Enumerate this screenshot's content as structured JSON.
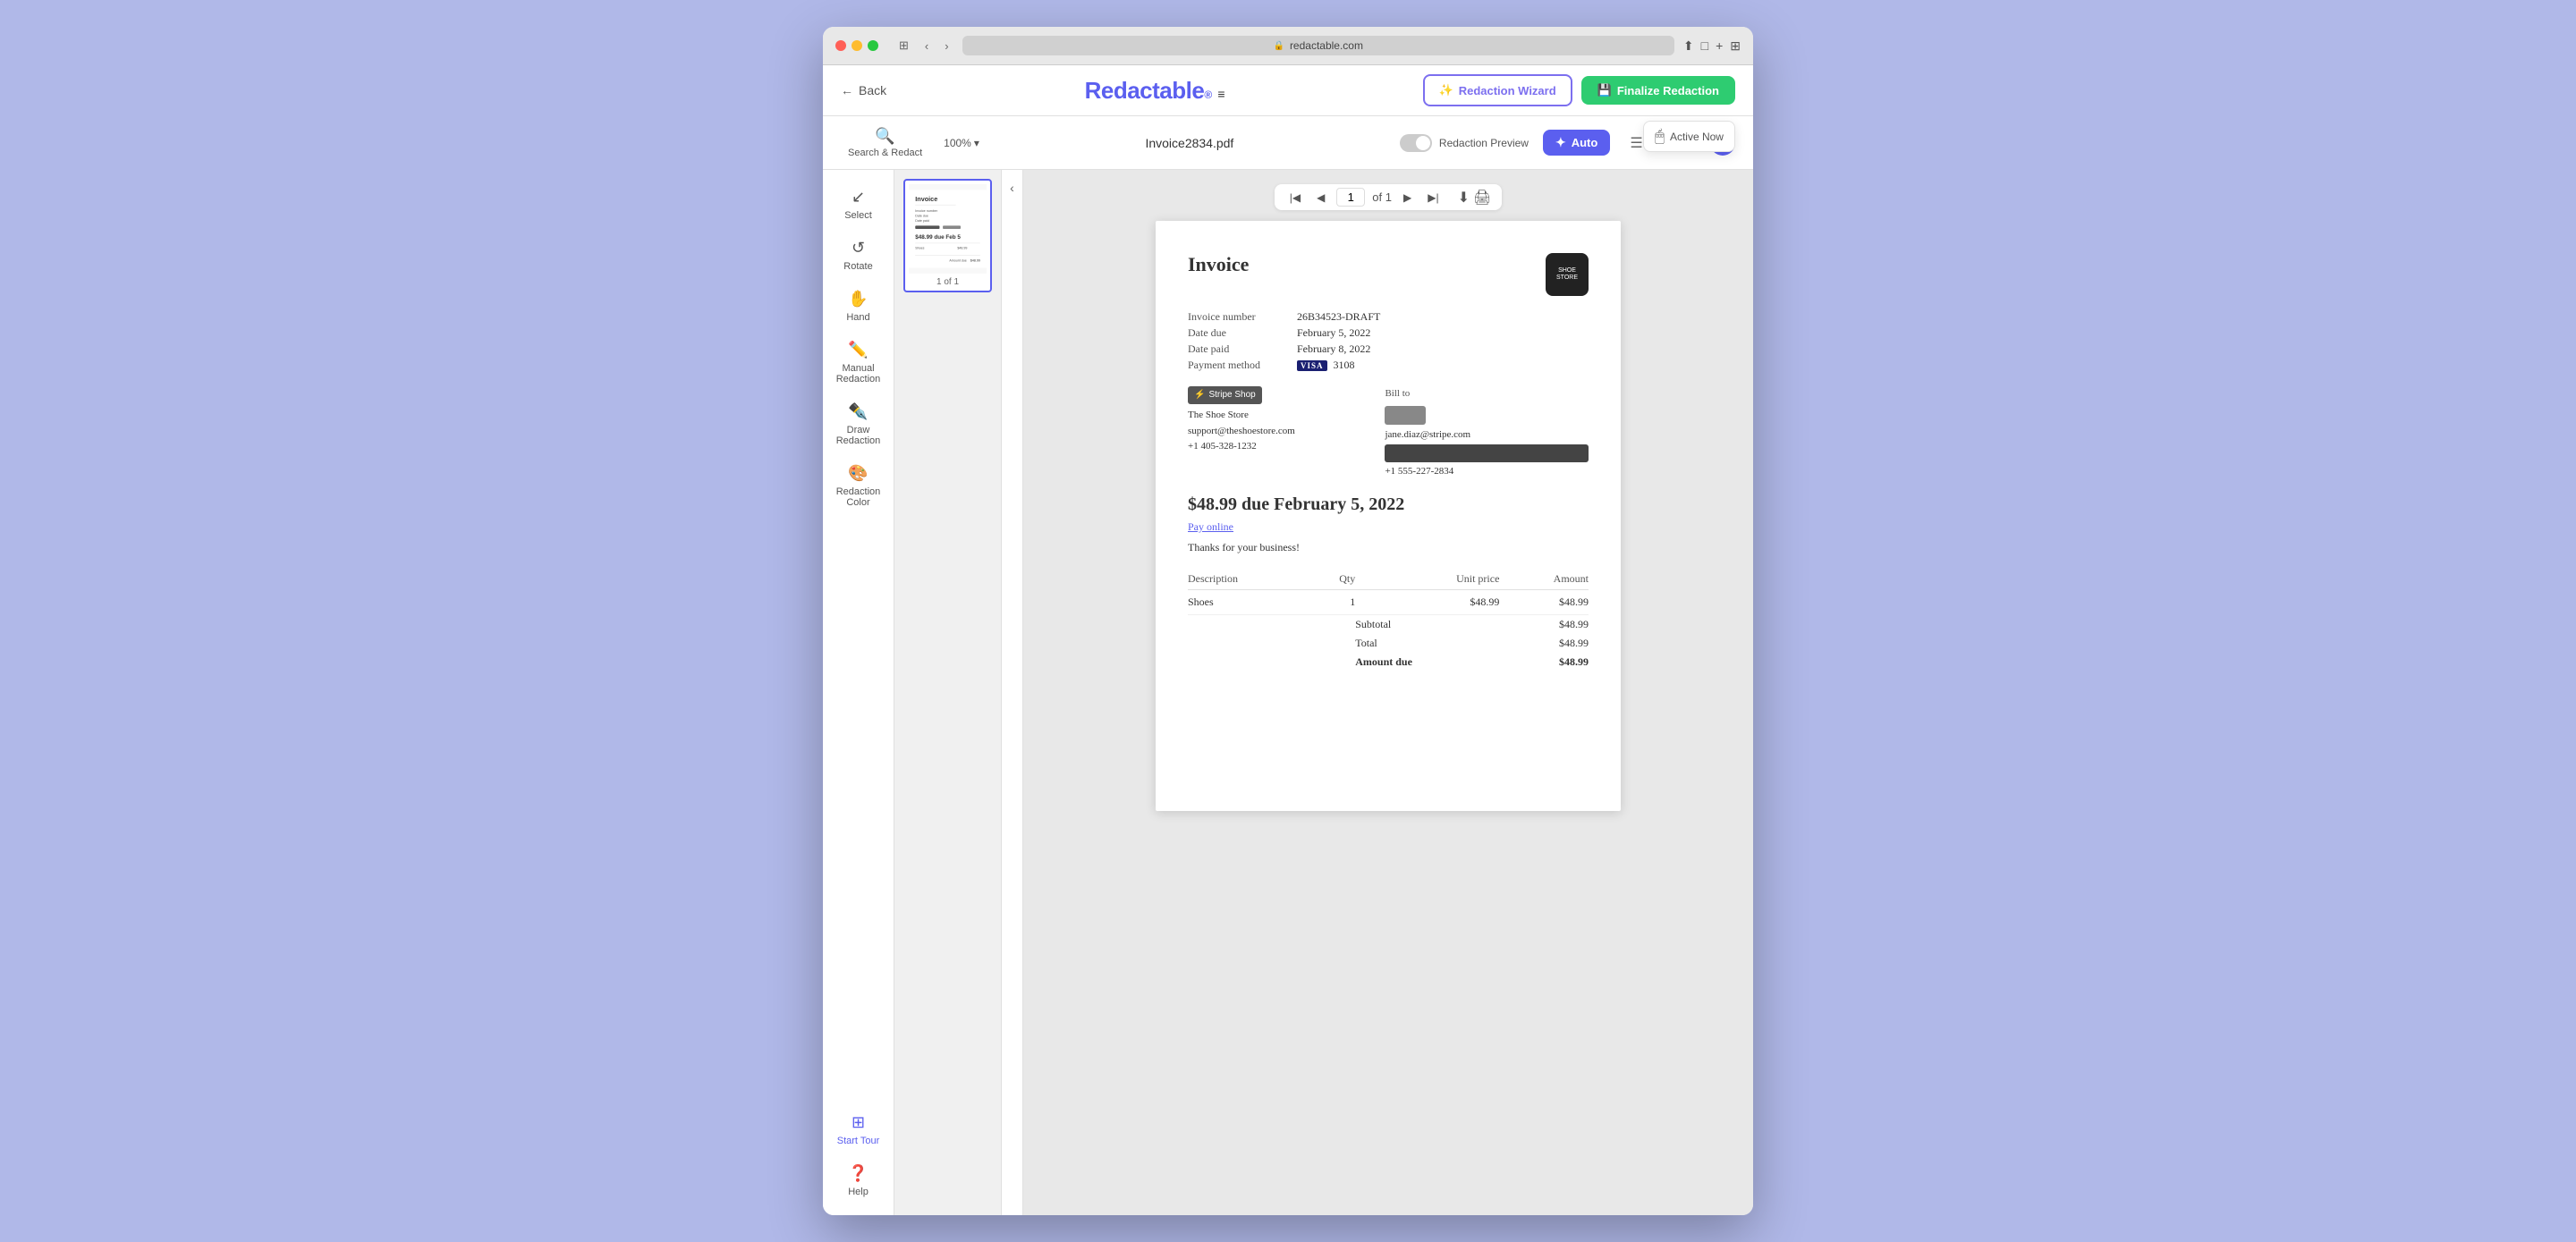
{
  "browser": {
    "url": "redactable.com",
    "traffic_lights": [
      "red",
      "yellow",
      "green"
    ]
  },
  "header": {
    "back_label": "Back",
    "logo": "Redactable",
    "logo_reg": "®",
    "wizard_label": "Redaction Wizard",
    "finalize_label": "Finalize Redaction",
    "active_now": "Active Now"
  },
  "toolbar": {
    "search_redact_label": "Search & Redact",
    "zoom_label": "100%",
    "filename": "Invoice2834.pdf",
    "redaction_preview_label": "Redaction Preview",
    "auto_label": "Auto",
    "page_current": "1",
    "page_total": "of 1"
  },
  "sidebar": {
    "items": [
      {
        "id": "select",
        "label": "Select",
        "icon": "↙"
      },
      {
        "id": "rotate",
        "label": "Rotate",
        "icon": "↺"
      },
      {
        "id": "hand",
        "label": "Hand",
        "icon": "✋"
      },
      {
        "id": "manual-redaction",
        "label": "Manual Redaction",
        "icon": "✏️"
      },
      {
        "id": "draw-redaction",
        "label": "Draw Redaction",
        "icon": "✒️"
      },
      {
        "id": "redaction-color",
        "label": "Redaction Color",
        "icon": "🎨"
      },
      {
        "id": "start-tour",
        "label": "Start Tour",
        "icon": "⊞"
      },
      {
        "id": "help",
        "label": "Help",
        "icon": "?"
      }
    ]
  },
  "invoice": {
    "title": "Invoice",
    "logo_text": "SHOE\nSTORE",
    "number_label": "Invoice number",
    "number_value": "26B34523-DRAFT",
    "date_label": "Date due",
    "date_value": "February 5, 2022",
    "paid_label": "Date paid",
    "paid_value": "February 8, 2022",
    "payment_label": "Payment method",
    "payment_card": "3108",
    "from_company": "The Shoe Store",
    "from_email": "support@theshoestore.com",
    "from_phone": "+1 405-328-1232",
    "bill_to_label": "Bill to",
    "bill_to_email": "jane.diaz@stripe.com",
    "bill_to_phone": "+1 555-227-2834",
    "amount_due_text": "$48.99 due February 5, 2022",
    "pay_online": "Pay online",
    "thanks": "Thanks for your business!",
    "table_headers": [
      "Description",
      "Qty",
      "Unit price",
      "Amount"
    ],
    "table_rows": [
      {
        "description": "Shoes",
        "qty": "1",
        "unit_price": "$48.99",
        "amount": "$48.99"
      }
    ],
    "subtotal_label": "Subtotal",
    "subtotal_value": "$48.99",
    "total_label": "Total",
    "total_value": "$48.99",
    "amount_due_label": "Amount due",
    "amount_due_value": "$48.99"
  },
  "thumbnail": {
    "label": "1 of 1"
  },
  "colors": {
    "accent": "#5b5fef",
    "green": "#2ecc71",
    "redact_dark": "#444444",
    "redact_mid": "#888888"
  }
}
